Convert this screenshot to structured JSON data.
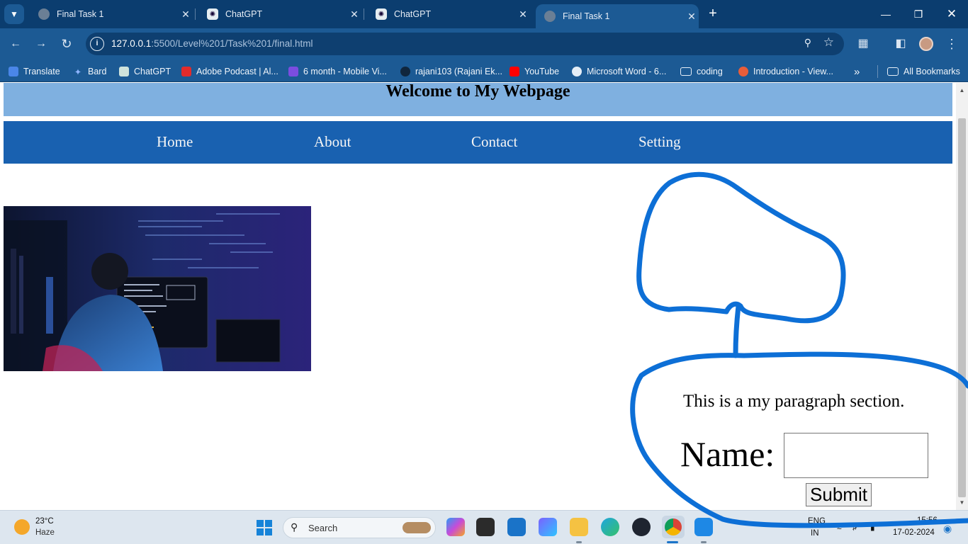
{
  "browser": {
    "tabs": [
      {
        "title": "Final Task 1",
        "icon": "globe-icon",
        "active": false
      },
      {
        "title": "ChatGPT",
        "icon": "chatgpt-icon",
        "active": false
      },
      {
        "title": "ChatGPT",
        "icon": "chatgpt-icon",
        "active": false
      },
      {
        "title": "Final Task 1",
        "icon": "globe-icon",
        "active": true
      }
    ],
    "url_host": "127.0.0.1",
    "url_path": ":5500/Level%201/Task%201/final.html",
    "bookmarks": [
      {
        "label": "Translate",
        "icon": "google-translate-icon"
      },
      {
        "label": "Bard",
        "icon": "bard-sparkle-icon"
      },
      {
        "label": "ChatGPT",
        "icon": "chatgpt-icon"
      },
      {
        "label": "Adobe Podcast | Al...",
        "icon": "adobe-icon"
      },
      {
        "label": "6 month - Mobile Vi...",
        "icon": "video-play-icon"
      },
      {
        "label": "rajani103 (Rajani Ek...",
        "icon": "github-icon"
      },
      {
        "label": "YouTube",
        "icon": "youtube-icon"
      },
      {
        "label": "Microsoft Word - 6...",
        "icon": "globe-icon"
      },
      {
        "label": "coding",
        "icon": "folder-icon"
      },
      {
        "label": "Introduction - View...",
        "icon": "site-icon"
      }
    ],
    "all_bookmarks_label": "All Bookmarks"
  },
  "page": {
    "heading": "Welcome to My Webpage",
    "nav": [
      "Home",
      "About",
      "Contact",
      "Setting"
    ],
    "image_alt": "Person at a computer with code on screens",
    "paragraph": "This is a my paragraph section.",
    "name_label": "Name:",
    "name_value": "",
    "submit_label": "Submit"
  },
  "taskbar": {
    "temperature": "23°C",
    "condition": "Haze",
    "search_placeholder": "Search",
    "lang_top": "ENG",
    "lang_bottom": "IN",
    "time": "15:56",
    "date": "17-02-2024"
  },
  "colors": {
    "header_bg": "#7fb0e0",
    "nav_bg": "#1961b0",
    "browser_frame": "#1c5a94",
    "annotation_stroke": "#0d6fd6"
  }
}
